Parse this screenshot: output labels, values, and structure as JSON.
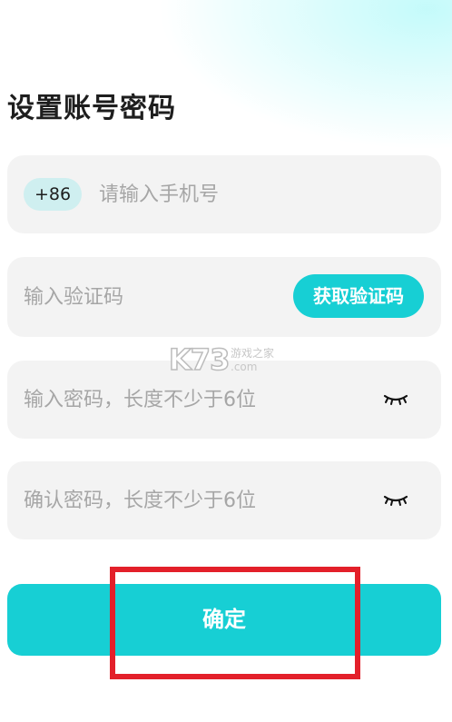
{
  "page": {
    "title": "设置账号密码"
  },
  "phone": {
    "country_code": "+86",
    "placeholder": "请输入手机号",
    "value": ""
  },
  "verification": {
    "placeholder": "输入验证码",
    "value": "",
    "get_code_label": "获取验证码"
  },
  "password": {
    "placeholder": "输入密码，长度不少于6位",
    "value": "",
    "toggle_icon": "eye-closed-icon"
  },
  "confirm_password": {
    "placeholder": "确认密码，长度不少于6位",
    "value": "",
    "toggle_icon": "eye-closed-icon"
  },
  "submit": {
    "label": "确定"
  },
  "watermark": {
    "logo": "K73",
    "site_name": "游戏之家",
    "domain": ".com"
  },
  "colors": {
    "accent": "#17cfd4",
    "field_bg": "#f3f3f3",
    "badge_bg": "#cfeff0",
    "placeholder": "#a6a6a6",
    "title": "#1e1e1e",
    "highlight": "#e3202a"
  }
}
